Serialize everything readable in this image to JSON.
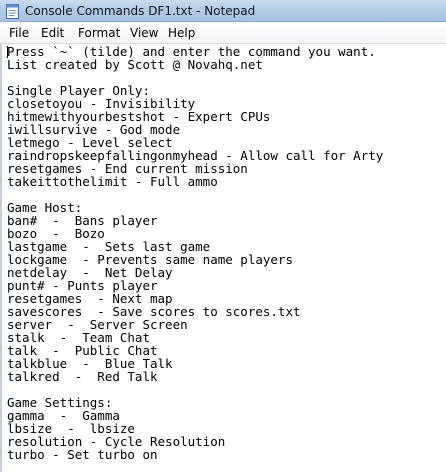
{
  "window": {
    "title": "Console Commands DF1.txt - Notepad"
  },
  "menu": [
    "File",
    "Edit",
    "Format",
    "View",
    "Help"
  ],
  "content": {
    "lines": [
      "Press `~` (tilde) and enter the command you want.",
      "List created by Scott @ Novahq.net",
      "",
      "Single Player Only:",
      "closetoyou - Invisibility",
      "hitmewithyourbestshot - Expert CPUs",
      "iwillsurvive - God mode",
      "letmego - Level select",
      "raindropskeepfallingonmyhead - Allow call for Arty",
      "resetgames - End current mission",
      "takeittothelimit - Full ammo",
      "",
      "Game Host:",
      "ban#  -  Bans player",
      "bozo  -  Bozo",
      "lastgame  -  Sets last game",
      "lockgame  - Prevents same name players",
      "netdelay  -  Net Delay",
      "punt# - Punts player",
      "resetgames  - Next map",
      "savescores  - Save scores to scores.txt",
      "server  -  Server Screen",
      "stalk  -  Team Chat",
      "talk  -  Public Chat",
      "talkblue  -  Blue Talk",
      "talkred  -  Red Talk",
      "",
      "Game Settings:",
      "gamma  -  Gamma",
      "lbsize  -  lbsize",
      "resolution - Cycle Resolution",
      "turbo - Set turbo on"
    ]
  }
}
